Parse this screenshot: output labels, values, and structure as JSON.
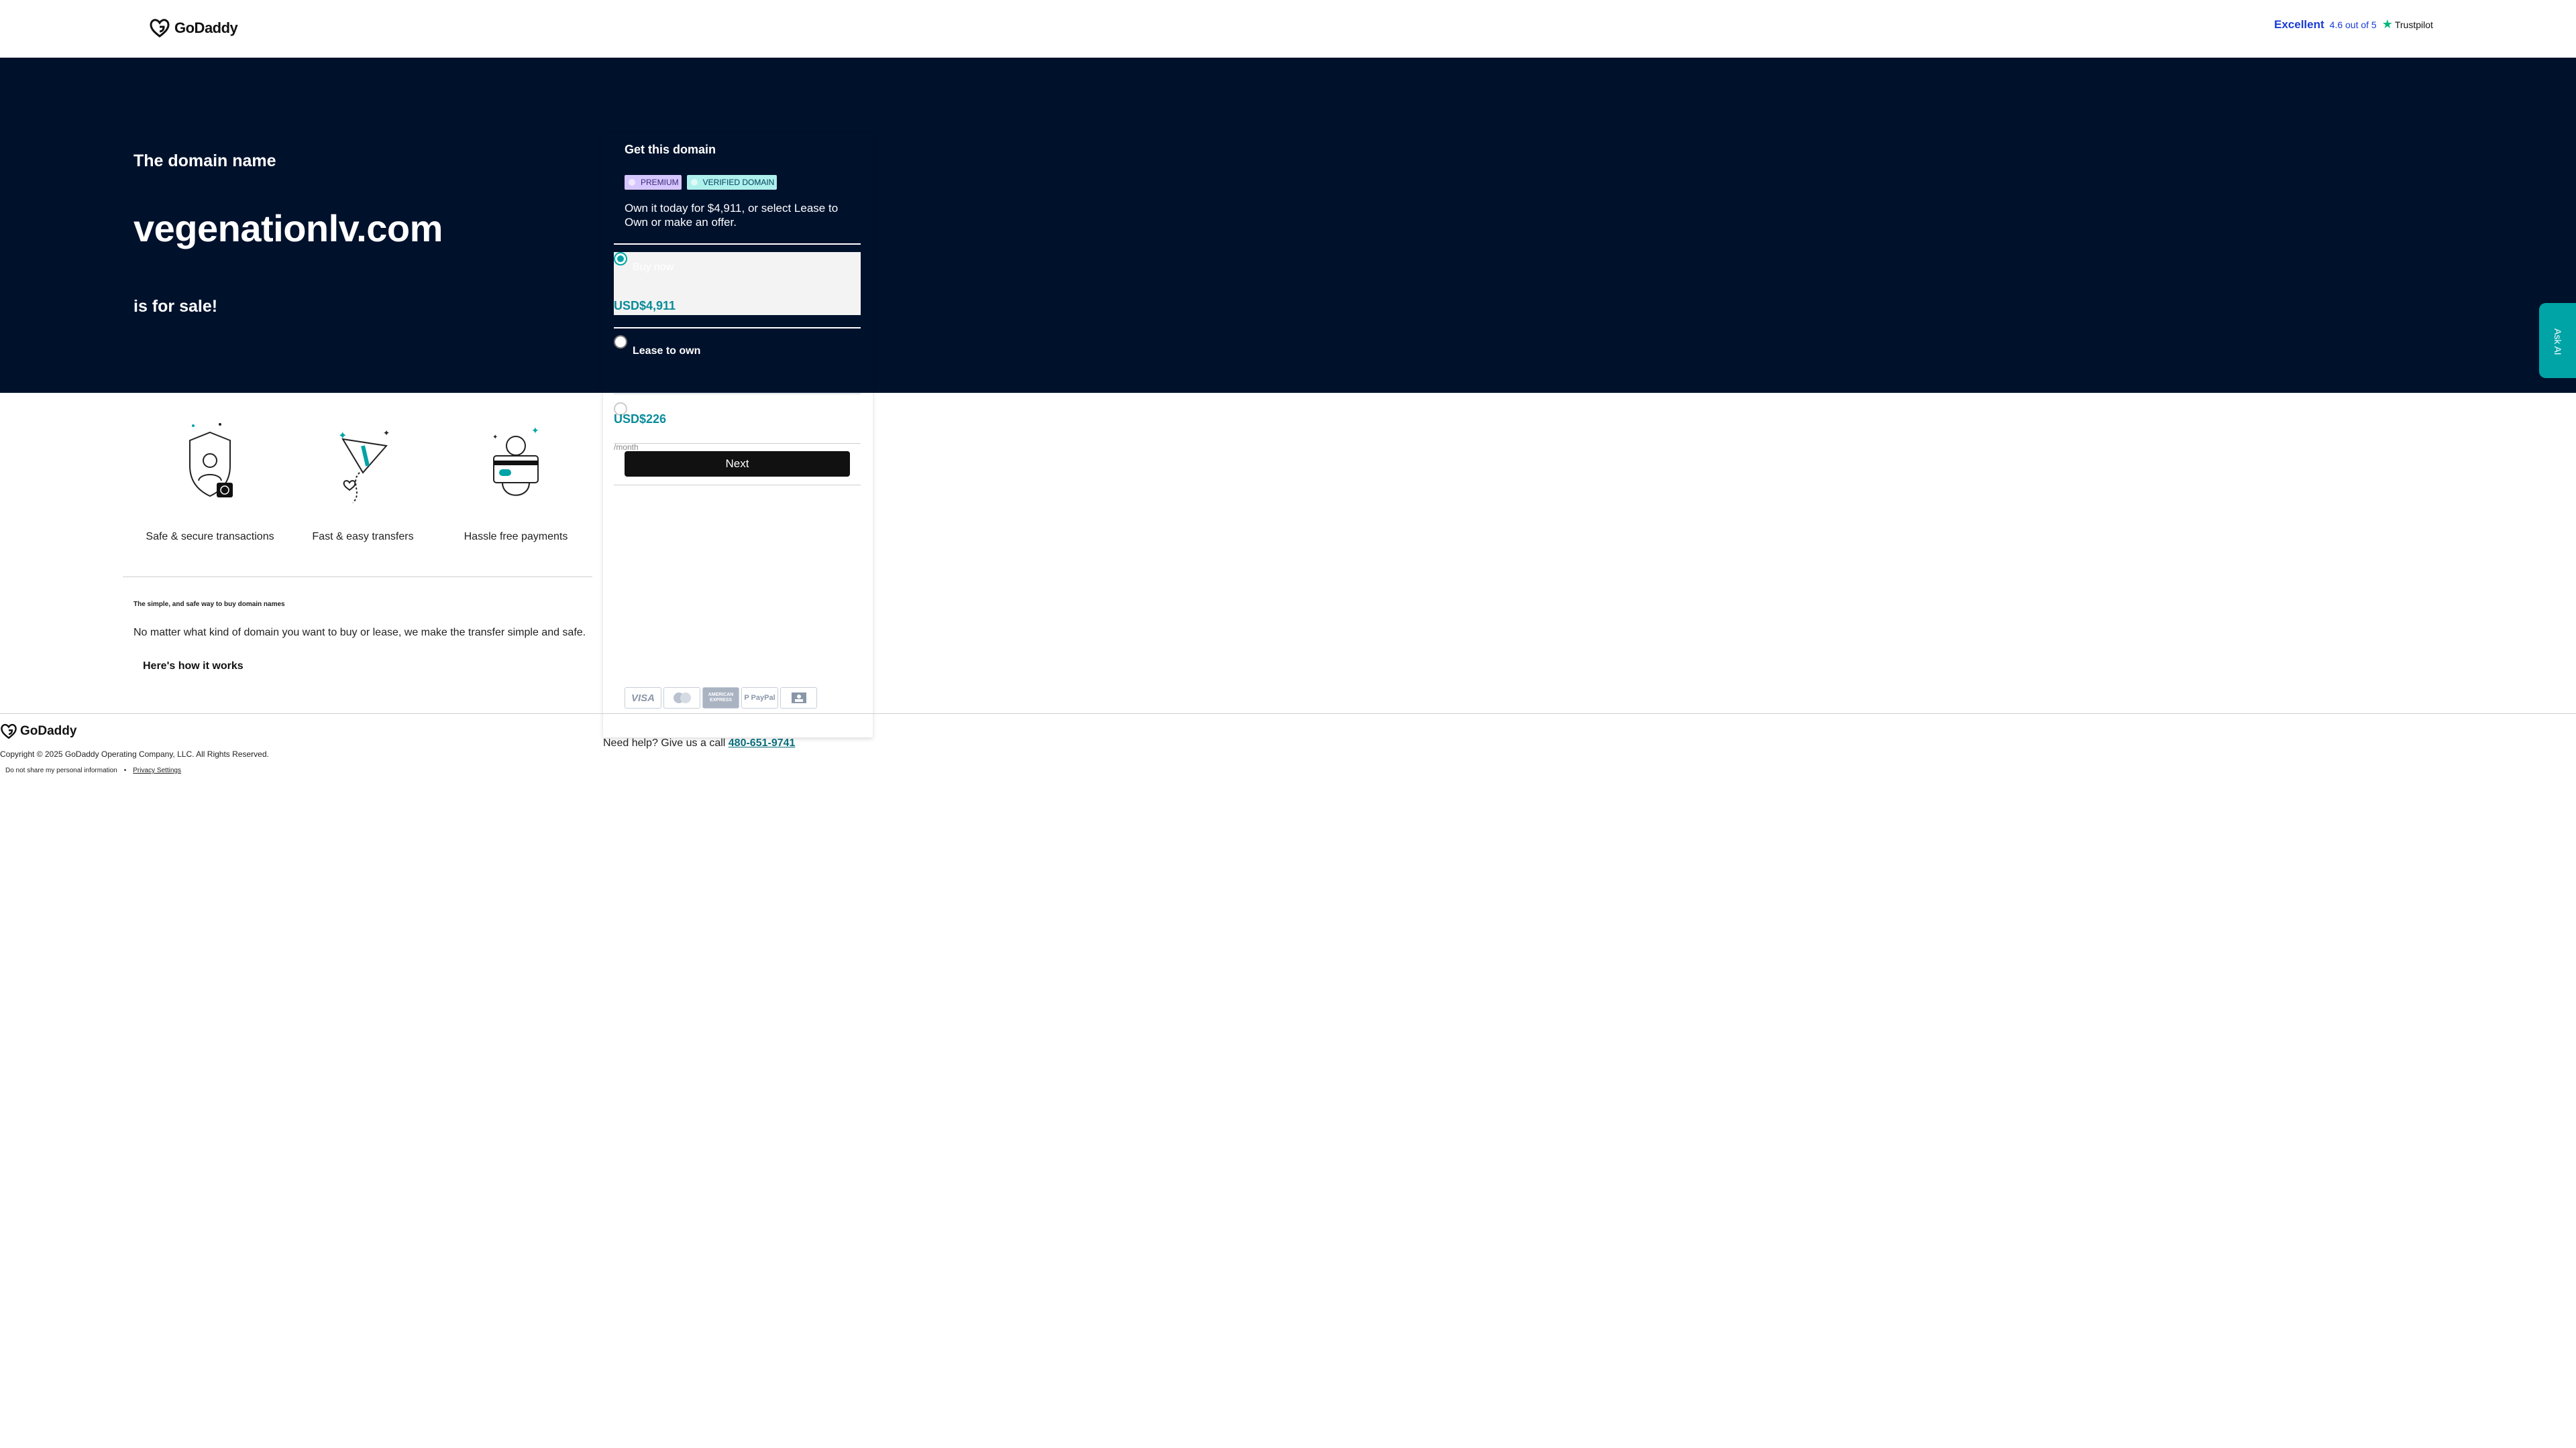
{
  "header": {
    "brand": "GoDaddy",
    "trustpilot": {
      "rating_word": "Excellent",
      "score_text": "4.6 out of 5",
      "brand": "Trustpilot"
    }
  },
  "hero": {
    "pre": "The domain name",
    "domain": "vegenationlv.com",
    "post": "is for sale!"
  },
  "ask_ai": {
    "label": "Ask AI"
  },
  "card": {
    "title": "Get this domain",
    "badges": [
      "PREMIUM",
      "VERIFIED DOMAIN"
    ],
    "offer_text": "Own it today for $4,911, or select Lease to Own or make an offer.",
    "options": [
      {
        "label": "Buy now",
        "price": "USD$4,911",
        "selected": true
      },
      {
        "label": "Lease to own",
        "price": "USD$226",
        "unit": "/month",
        "selected": false
      }
    ],
    "next_label": "Next",
    "payment_methods": [
      "VISA",
      "Mastercard",
      "American Express",
      "PayPal",
      "Bank"
    ]
  },
  "features": [
    {
      "label": "Safe & secure transactions",
      "icon": "shield-icon"
    },
    {
      "label": "Fast & easy transfers",
      "icon": "paper-plane-icon"
    },
    {
      "label": "Hassle free payments",
      "icon": "payment-card-icon"
    }
  ],
  "how": {
    "small_title": "The simple, and safe way to buy domain names",
    "body": "No matter what kind of domain you want to buy or lease, we make the transfer simple and safe.",
    "link": "Here's how it works"
  },
  "footer": {
    "brand": "GoDaddy",
    "copyright": "Copyright © 2025 GoDaddy Operating Company, LLC. All Rights Reserved.",
    "dont_share": "Do not share my personal information",
    "privacy": "Privacy Settings",
    "help_text": "Need help? Give us a call",
    "phone": "480-651-9741"
  },
  "colors": {
    "hero_bg": "#00112c",
    "accent": "#00a4a6",
    "price": "#0a8c9a"
  }
}
